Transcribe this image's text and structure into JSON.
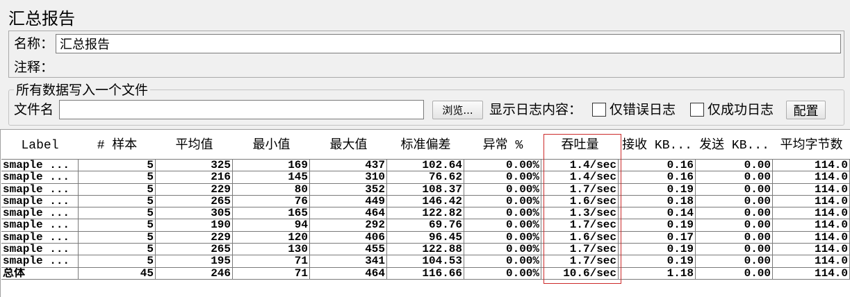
{
  "panel": {
    "title": "汇总报告",
    "name_label": "名称：",
    "name_value": "汇总报告",
    "comment_label": "注释："
  },
  "file_output": {
    "legend": "所有数据写入一个文件",
    "filename_label": "文件名",
    "filename_value": "",
    "browse_label": "浏览...",
    "log_label": "显示日志内容：",
    "errors_only_label": "仅错误日志",
    "errors_only_checked": false,
    "success_only_label": "仅成功日志",
    "success_only_checked": false,
    "config_label": "配置"
  },
  "table": {
    "columns": [
      "Label",
      "# 样本",
      "平均值",
      "最小值",
      "最大值",
      "标准偏差",
      "异常 %",
      "吞吐量",
      "接收 KB...",
      "发送 KB...",
      "平均字节数"
    ],
    "rows": [
      [
        "smaple ...",
        "5",
        "325",
        "169",
        "437",
        "102.64",
        "0.00%",
        "1.4/sec",
        "0.16",
        "0.00",
        "114.0"
      ],
      [
        "smaple ...",
        "5",
        "216",
        "145",
        "310",
        "76.62",
        "0.00%",
        "1.4/sec",
        "0.16",
        "0.00",
        "114.0"
      ],
      [
        "smaple ...",
        "5",
        "229",
        "80",
        "352",
        "108.37",
        "0.00%",
        "1.7/sec",
        "0.19",
        "0.00",
        "114.0"
      ],
      [
        "smaple ...",
        "5",
        "265",
        "76",
        "449",
        "146.42",
        "0.00%",
        "1.6/sec",
        "0.18",
        "0.00",
        "114.0"
      ],
      [
        "smaple ...",
        "5",
        "305",
        "165",
        "464",
        "122.82",
        "0.00%",
        "1.3/sec",
        "0.14",
        "0.00",
        "114.0"
      ],
      [
        "smaple ...",
        "5",
        "190",
        "94",
        "292",
        "69.76",
        "0.00%",
        "1.7/sec",
        "0.19",
        "0.00",
        "114.0"
      ],
      [
        "smaple ...",
        "5",
        "229",
        "120",
        "406",
        "96.45",
        "0.00%",
        "1.6/sec",
        "0.17",
        "0.00",
        "114.0"
      ],
      [
        "smaple ...",
        "5",
        "265",
        "130",
        "455",
        "122.88",
        "0.00%",
        "1.7/sec",
        "0.19",
        "0.00",
        "114.0"
      ],
      [
        "smaple ...",
        "5",
        "195",
        "71",
        "341",
        "104.53",
        "0.00%",
        "1.7/sec",
        "0.19",
        "0.00",
        "114.0"
      ]
    ],
    "total": [
      "总体",
      "45",
      "246",
      "71",
      "464",
      "116.66",
      "0.00%",
      "10.6/sec",
      "1.18",
      "0.00",
      "114.0"
    ]
  },
  "colors": {
    "highlight": "#cc2a2a"
  }
}
